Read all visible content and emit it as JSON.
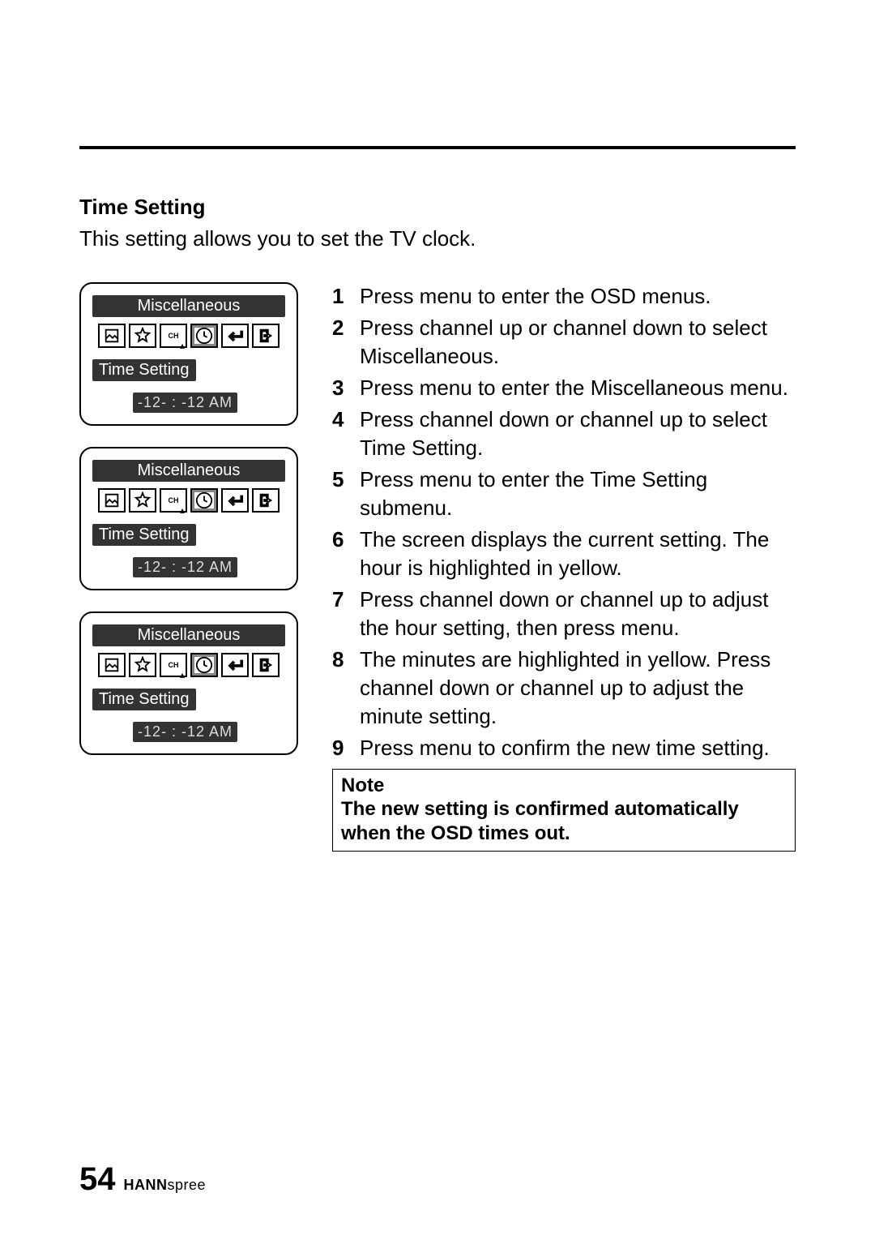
{
  "heading": "Time Setting",
  "lead": "This setting allows you to set the TV clock.",
  "osd": {
    "title": "Miscellaneous",
    "item": "Time Setting",
    "value_hh": "-12-",
    "value_sep": ":",
    "value_mm": "-12",
    "value_ampm": "AM",
    "icons": [
      {
        "name": "picture-icon"
      },
      {
        "name": "star-icon"
      },
      {
        "name": "channel-icon",
        "label": "CH"
      },
      {
        "name": "clock-icon",
        "selected": true
      },
      {
        "name": "enter-icon"
      },
      {
        "name": "exit-icon"
      }
    ]
  },
  "steps": [
    "Press menu to enter the OSD menus.",
    "Press channel up or channel down to select Miscellaneous.",
    "Press menu to enter the Miscellaneous menu.",
    "Press channel down or channel up to select Time Setting.",
    "Press menu to enter the Time Setting submenu.",
    "The screen displays the current setting. The hour is highlighted in yellow.",
    "Press channel down or channel up to adjust the hour setting, then press menu.",
    "The minutes are highlighted in yellow. Press channel down or channel up to adjust the minute setting.",
    "Press menu to confirm the new time setting."
  ],
  "note": {
    "label": "Note",
    "text": "The new setting is confirmed automatically when the OSD times out."
  },
  "page_number": "54",
  "brand_bold": "HANN",
  "brand_rest": "spree"
}
